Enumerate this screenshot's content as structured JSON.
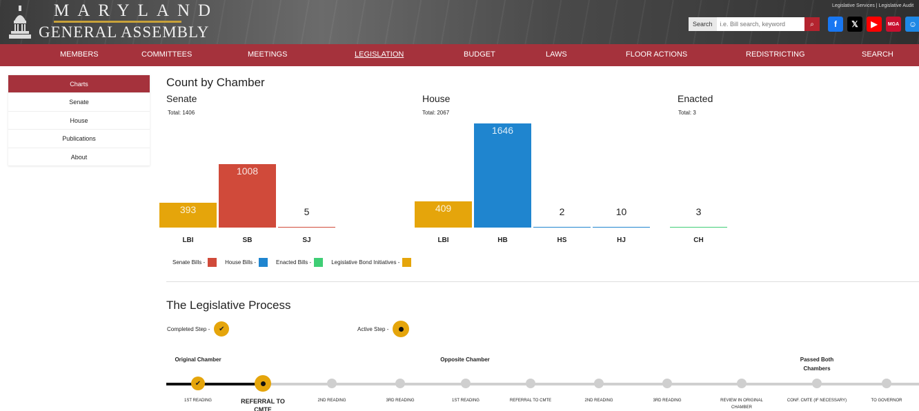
{
  "header": {
    "logo_line1": "MARYLAND",
    "logo_line2": "GENERAL ASSEMBLY",
    "search_label": "Search",
    "search_placeholder": "i.e. Bill search, keyword",
    "top_links": "Legislative Services  |  Legislative Audit",
    "social": [
      {
        "name": "facebook-icon",
        "glyph": "f",
        "color": "#1877f2"
      },
      {
        "name": "x-icon",
        "glyph": "𝕏",
        "color": "#000000"
      },
      {
        "name": "youtube-icon",
        "glyph": "▶",
        "color": "#ff0000"
      },
      {
        "name": "mymga-icon",
        "glyph": "MGA",
        "color": "#c8102e"
      },
      {
        "name": "accessibility-icon",
        "glyph": "☺",
        "color": "#1e88e5"
      }
    ]
  },
  "nav": [
    "MEMBERS",
    "COMMITTEES",
    "MEETINGS",
    "LEGISLATION",
    "BUDGET",
    "LAWS",
    "FLOOR ACTIONS",
    "REDISTRICTING",
    "SEARCH"
  ],
  "nav_active": "LEGISLATION",
  "sidebar": [
    "Charts",
    "Senate",
    "House",
    "Publications",
    "About"
  ],
  "sidebar_active": "Charts",
  "count": {
    "title": "Count by Chamber",
    "senate_title": "Senate",
    "senate_total": "Total: 1406",
    "house_title": "House",
    "house_total": "Total: 2067",
    "enacted_title": "Enacted",
    "enacted_total": "Total: 3"
  },
  "chart_data": {
    "type": "bar",
    "groups": [
      {
        "name": "Senate",
        "bars": [
          {
            "category": "LBI",
            "value": 393,
            "color": "#e5a50b"
          },
          {
            "category": "SB",
            "value": 1008,
            "color": "#d04a3a"
          },
          {
            "category": "SJ",
            "value": 5,
            "color": "#d04a3a"
          }
        ]
      },
      {
        "name": "House",
        "bars": [
          {
            "category": "LBI",
            "value": 409,
            "color": "#e5a50b"
          },
          {
            "category": "HB",
            "value": 1646,
            "color": "#1f85cf"
          },
          {
            "category": "HS",
            "value": 2,
            "color": "#1f85cf"
          },
          {
            "category": "HJ",
            "value": 10,
            "color": "#1f85cf"
          }
        ]
      },
      {
        "name": "Enacted",
        "bars": [
          {
            "category": "CH",
            "value": 3,
            "color": "#3fce75"
          }
        ]
      }
    ],
    "legend": [
      {
        "label": "Senate Bills -",
        "color": "#d04a3a"
      },
      {
        "label": "House Bills -",
        "color": "#1f85cf"
      },
      {
        "label": "Enacted Bills -",
        "color": "#3fce75"
      },
      {
        "label": "Legislative Bond Initiatives -",
        "color": "#e5a50b"
      }
    ]
  },
  "process": {
    "title": "The Legislative Process",
    "completed_label": "Completed Step -",
    "active_label": "Active Step -",
    "phases": [
      "Original Chamber",
      "Opposite Chamber",
      "Passed Both Chambers"
    ],
    "steps": [
      {
        "label": "1ST READING",
        "state": "done"
      },
      {
        "label": "REFERRAL TO CMTE",
        "state": "active"
      },
      {
        "label": "2ND READING",
        "state": "pending"
      },
      {
        "label": "3RD READING",
        "state": "pending"
      },
      {
        "label": "1ST READING",
        "state": "pending"
      },
      {
        "label": "REFERRAL TO CMTE",
        "state": "pending"
      },
      {
        "label": "2ND READING",
        "state": "pending"
      },
      {
        "label": "3RD READING",
        "state": "pending"
      },
      {
        "label": "REVIEW IN ORIGINAL CHAMBER",
        "state": "pending"
      },
      {
        "label": "CONF. CMTE (IF NECESSARY)",
        "state": "pending"
      },
      {
        "label": "TO GOVERNOR",
        "state": "pending"
      }
    ]
  }
}
